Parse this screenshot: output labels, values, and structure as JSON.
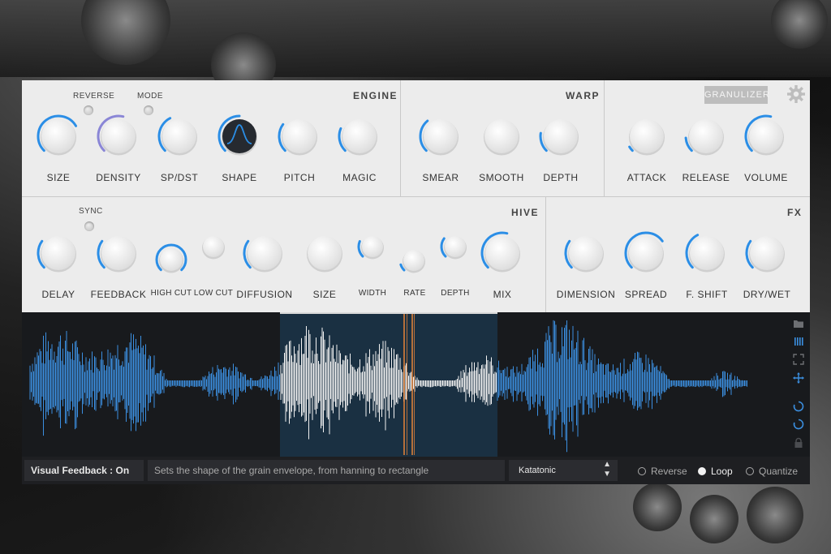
{
  "engine": {
    "title": "ENGINE",
    "reverse_label": "REVERSE",
    "mode_label": "MODE",
    "knobs": [
      {
        "label": "SIZE",
        "value": 0.72
      },
      {
        "label": "DENSITY",
        "value": 0.55
      },
      {
        "label": "SP/DST",
        "value": 0.4
      },
      {
        "label": "SHAPE",
        "value": 0.5
      },
      {
        "label": "PITCH",
        "value": 0.3
      },
      {
        "label": "MAGIC",
        "value": 0.25
      }
    ]
  },
  "warp": {
    "title": "WARP",
    "knobs": [
      {
        "label": "SMEAR",
        "value": 0.35
      },
      {
        "label": "SMOOTH",
        "value": 0.0
      },
      {
        "label": "DEPTH",
        "value": 0.2
      }
    ]
  },
  "granulizer": {
    "badge": "GRANULIZER",
    "knobs": [
      {
        "label": "ATTACK",
        "value": 0.05
      },
      {
        "label": "RELEASE",
        "value": 0.15
      },
      {
        "label": "VOLUME",
        "value": 0.55
      }
    ]
  },
  "hive": {
    "title": "HIVE",
    "sync_label": "SYNC",
    "knobs": [
      {
        "label": "DELAY",
        "value": 0.3
      },
      {
        "label": "FEEDBACK",
        "value": 0.3
      },
      {
        "label": "HIGH CUT",
        "value": 1.0
      },
      {
        "label": "LOW CUT",
        "value": 0.0
      },
      {
        "label": "DIFFUSION",
        "value": 0.3
      },
      {
        "label": "SIZE",
        "value": 0.0
      },
      {
        "label": "WIDTH",
        "value": 0.25
      },
      {
        "label": "RATE",
        "value": 0.1
      },
      {
        "label": "DEPTH",
        "value": 0.3
      },
      {
        "label": "MIX",
        "value": 0.55
      }
    ]
  },
  "fx": {
    "title": "FX",
    "knobs": [
      {
        "label": "DIMENSION",
        "value": 0.3
      },
      {
        "label": "SPREAD",
        "value": 0.7
      },
      {
        "label": "F. SHIFT",
        "value": 0.4
      },
      {
        "label": "DRY/WET",
        "value": 0.3
      }
    ]
  },
  "footer": {
    "visual_feedback": "Visual Feedback : On",
    "hint": "Sets the shape of the grain envelope, from hanning to rectangle",
    "preset": "Katatonic",
    "options": [
      {
        "label": "Reverse",
        "on": false
      },
      {
        "label": "Loop",
        "on": true
      },
      {
        "label": "Quantize",
        "on": false
      }
    ]
  },
  "colors": {
    "accent": "#2b8ee6",
    "density": "#8a86d6",
    "panel": "#ececec",
    "waveform": "#3b8fe0",
    "selection": "#1b3347",
    "playhead": "#d07a3a"
  }
}
